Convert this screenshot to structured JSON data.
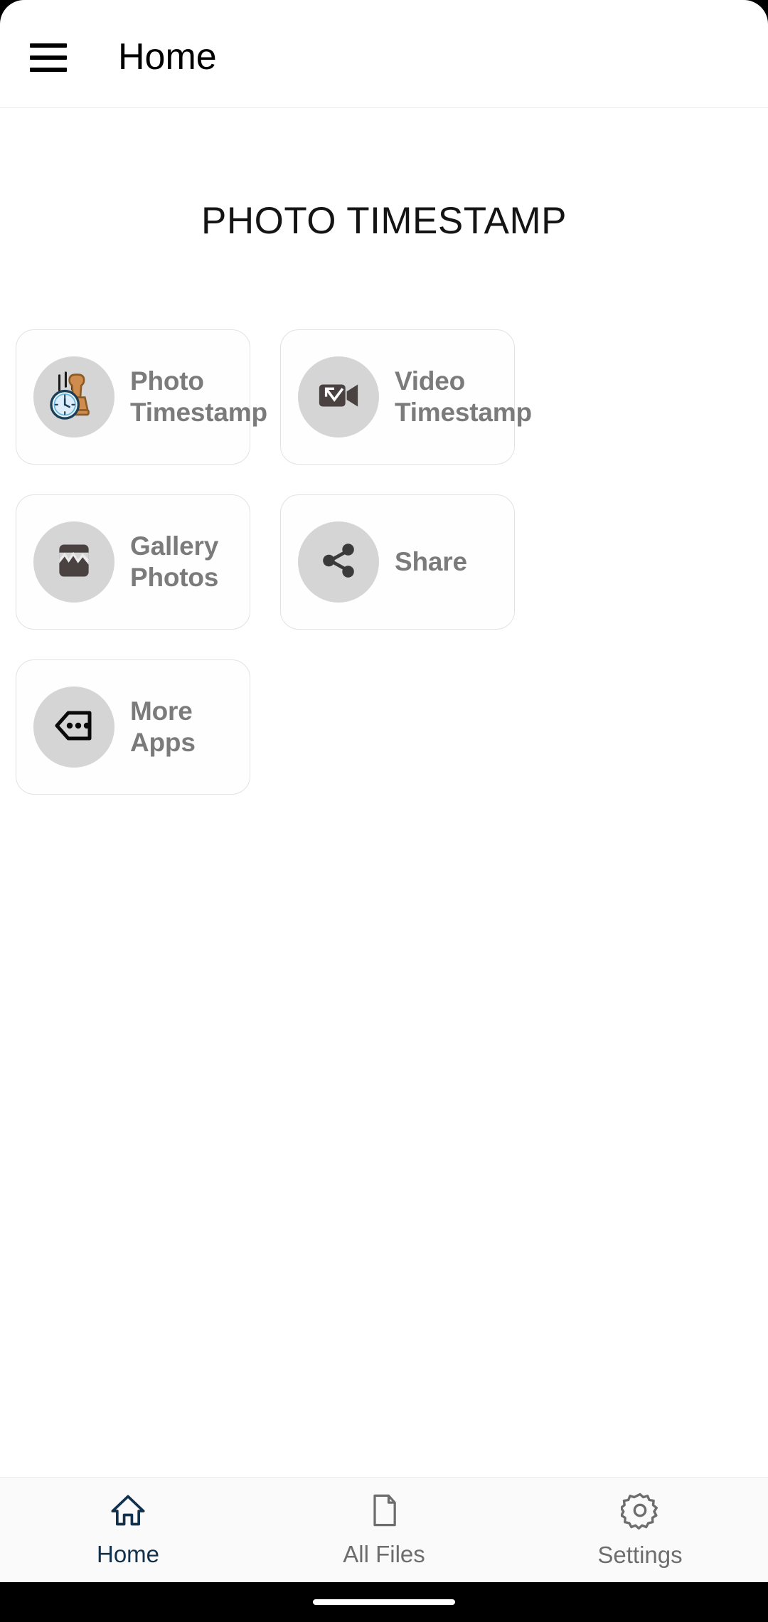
{
  "appbar": {
    "menu_icon": "hamburger-menu-icon",
    "title": "Home"
  },
  "main": {
    "page_title": "PHOTO TIMESTAMP",
    "cards": [
      {
        "label_line1": "Photo",
        "label_line2": "Timestamp",
        "icon": "stamp-clock-icon"
      },
      {
        "label_line1": "Video",
        "label_line2": "Timestamp",
        "icon": "video-camera-icon"
      },
      {
        "label_line1": "Gallery",
        "label_line2": "Photos",
        "icon": "image-gallery-icon"
      },
      {
        "label_line1": "Share",
        "label_line2": "",
        "icon": "share-icon"
      },
      {
        "label_line1": "More Apps",
        "label_line2": "",
        "icon": "more-apps-tag-icon"
      }
    ]
  },
  "bottomnav": {
    "items": [
      {
        "label": "Home",
        "icon": "home-icon",
        "active": true
      },
      {
        "label": "All Files",
        "icon": "document-icon",
        "active": false
      },
      {
        "label": "Settings",
        "icon": "gear-icon",
        "active": false
      }
    ]
  },
  "colors": {
    "accent": "#12314d",
    "card_border": "#e2e2e2",
    "icon_circle": "#d5d5d5",
    "label_gray": "#7b7b7b",
    "inactive_gray": "#6d6d6d",
    "stamp_brown": "#cf8c4e",
    "dark_icon": "#4a4241"
  }
}
